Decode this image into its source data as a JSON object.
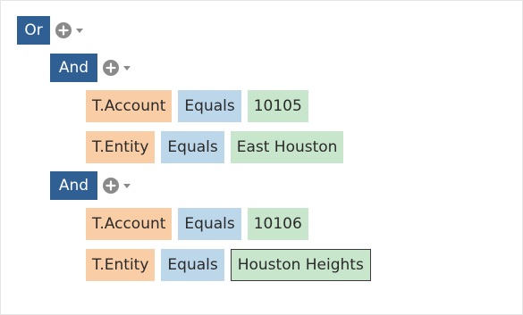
{
  "root": {
    "operator": "Or"
  },
  "groups": [
    {
      "operator": "And",
      "conditions": [
        {
          "field": "T.Account",
          "comparison": "Equals",
          "value": "10105"
        },
        {
          "field": "T.Entity",
          "comparison": "Equals",
          "value": "East Houston"
        }
      ]
    },
    {
      "operator": "And",
      "conditions": [
        {
          "field": "T.Account",
          "comparison": "Equals",
          "value": "10106"
        },
        {
          "field": "T.Entity",
          "comparison": "Equals",
          "value": "Houston Heights"
        }
      ]
    }
  ],
  "icons": {
    "add": "plus-circle-icon",
    "dropdown": "chevron-down-icon"
  },
  "colors": {
    "operator_bg": "#2f5f93",
    "field_bg": "#f9cda6",
    "comparison_bg": "#bcd6ea",
    "value_bg": "#c8e6cc"
  }
}
